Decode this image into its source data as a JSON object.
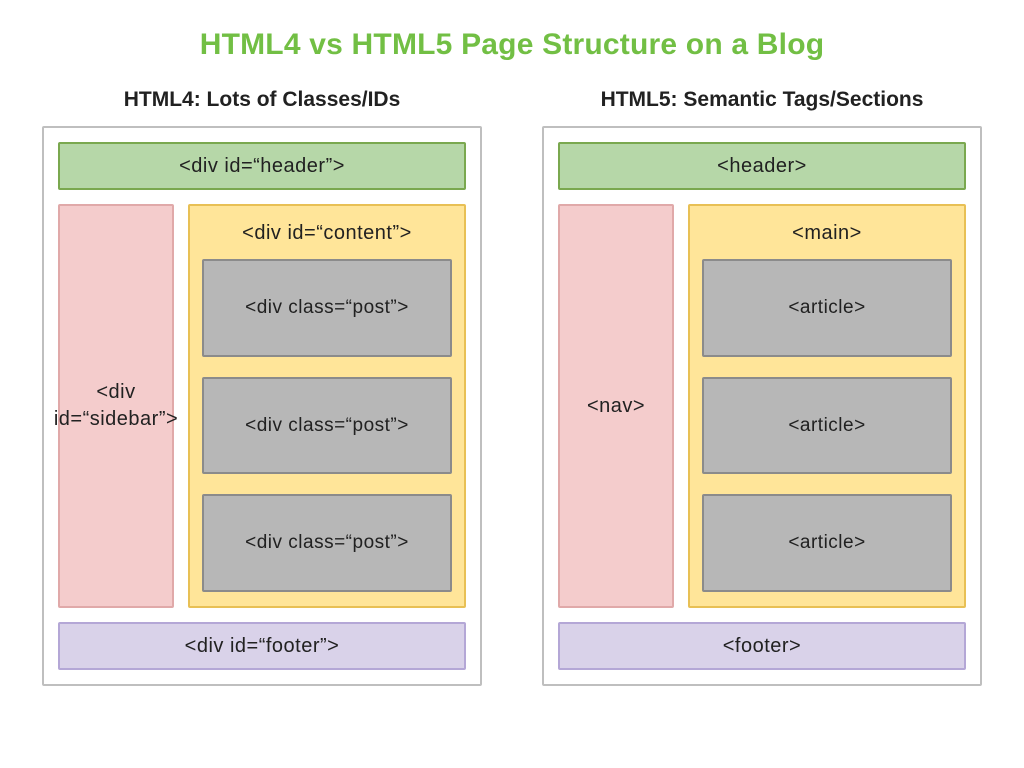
{
  "title": "HTML4 vs HTML5 Page Structure on a Blog",
  "left": {
    "subtitle": "HTML4: Lots of Classes/IDs",
    "header": "<div id=“header”>",
    "sidebar": "<div id=“sidebar”>",
    "content": "<div id=“content”>",
    "posts": [
      "<div class=“post”>",
      "<div class=“post”>",
      "<div class=“post”>"
    ],
    "footer": "<div id=“footer”>"
  },
  "right": {
    "subtitle": "HTML5: Semantic Tags/Sections",
    "header": "<header>",
    "sidebar": "<nav>",
    "content": "<main>",
    "posts": [
      "<article>",
      "<article>",
      "<article>"
    ],
    "footer": "<footer>"
  }
}
